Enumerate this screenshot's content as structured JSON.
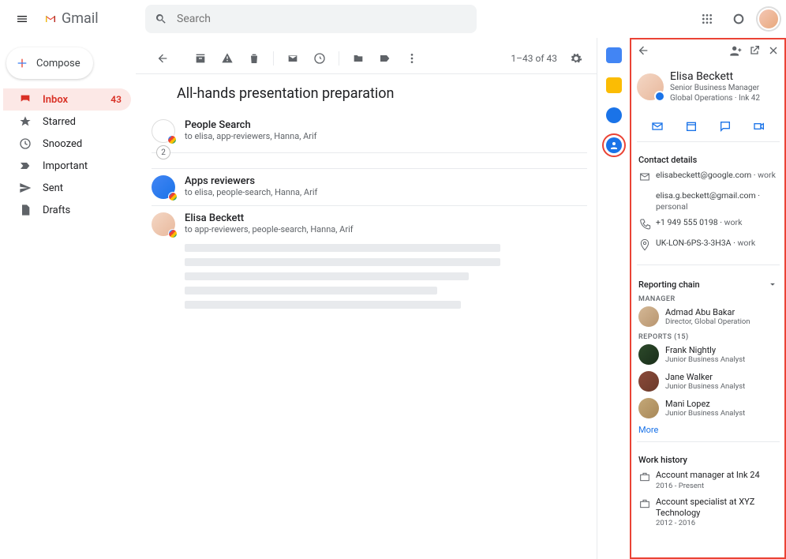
{
  "app": {
    "name": "Gmail",
    "search_placeholder": "Search"
  },
  "compose_label": "Compose",
  "nav": [
    {
      "label": "Inbox",
      "count": "43",
      "active": true
    },
    {
      "label": "Starred",
      "count": "",
      "active": false
    },
    {
      "label": "Snoozed",
      "count": "",
      "active": false
    },
    {
      "label": "Important",
      "count": "",
      "active": false
    },
    {
      "label": "Sent",
      "count": "",
      "active": false
    },
    {
      "label": "Drafts",
      "count": "",
      "active": false
    }
  ],
  "toolbar": {
    "counter": "1–43 of 43"
  },
  "thread": {
    "subject": "All-hands presentation preparation",
    "collapsed_count": "2",
    "messages": [
      {
        "from": "People Search",
        "to": "to elisa, app-reviewers, Hanna, Arif"
      },
      {
        "from": "Apps reviewers",
        "to": "to elisa, people-search, Hanna, Arif"
      },
      {
        "from": "Elisa Beckett",
        "to": "to app-reviewers, people-search, Hanna, Arif"
      }
    ]
  },
  "contact": {
    "name": "Elisa Beckett",
    "title": "Senior Business Manager",
    "org": "Global Operations",
    "desk": "Ink 42",
    "details_header": "Contact details",
    "emails": [
      {
        "value": "elisabeckett@google.com",
        "tag": "work"
      },
      {
        "value": "elisa.g.beckett@gmail.com",
        "tag": "personal"
      }
    ],
    "phone": {
      "value": "+1 949 555 0198",
      "tag": "work"
    },
    "location": {
      "value": "UK-LON-6PS-3-3H3A",
      "tag": "work"
    },
    "reporting_header": "Reporting chain",
    "manager_header": "MANAGER",
    "manager": {
      "name": "Admad Abu Bakar",
      "role": "Director, Global Operation"
    },
    "reports_header": "REPORTS (15)",
    "reports": [
      {
        "name": "Frank Nightly",
        "role": "Junior Business Analyst"
      },
      {
        "name": "Jane Walker",
        "role": "Junior Business Analyst"
      },
      {
        "name": "Mani Lopez",
        "role": "Junior Business Analyst"
      }
    ],
    "more_label": "More",
    "workhistory_header": "Work history",
    "work_history": [
      {
        "title": "Account manager at Ink 24",
        "dates": "2016 - Present"
      },
      {
        "title": "Account specialist at XYZ Technology",
        "dates": "2012 - 2016"
      }
    ]
  }
}
